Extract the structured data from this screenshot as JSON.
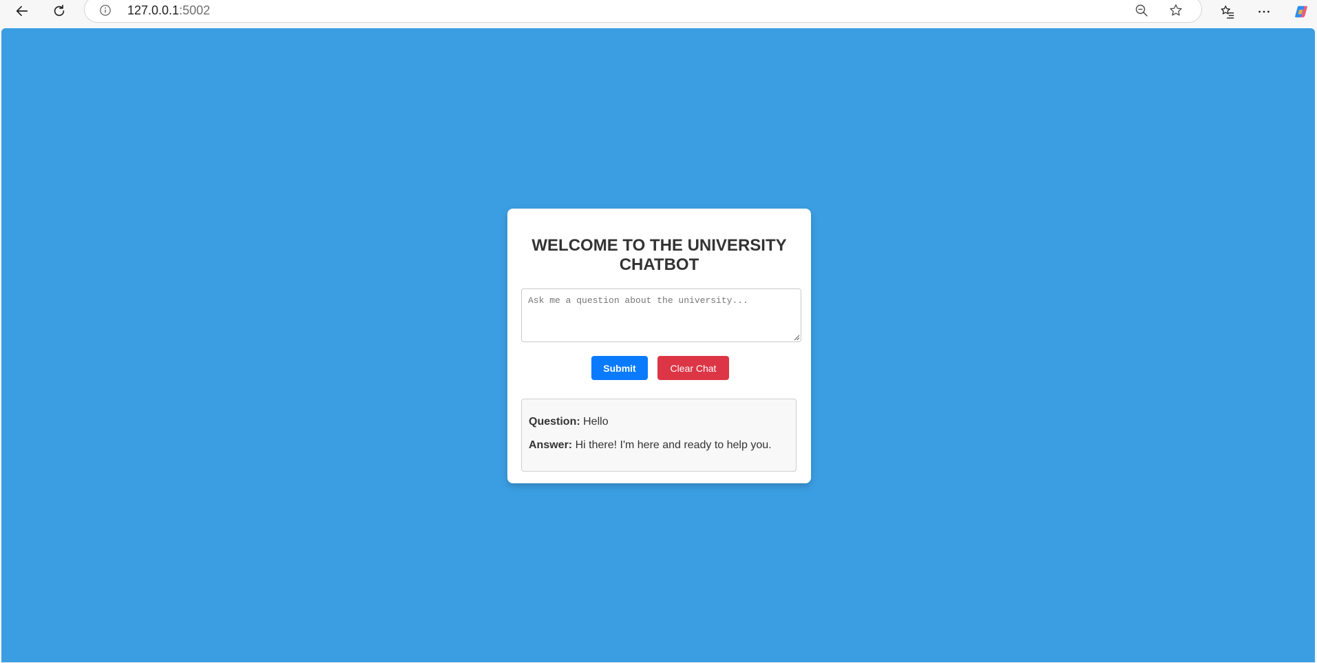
{
  "browser": {
    "url_host": "127.0.0.1",
    "url_port": ":5002",
    "icons": {
      "back": "back-arrow-icon",
      "reload": "reload-icon",
      "info": "info-icon",
      "zoom": "zoom-out-icon",
      "favorite": "star-icon",
      "favorites": "favorites-list-icon",
      "more": "more-dots-icon",
      "copilot": "copilot-icon"
    }
  },
  "page": {
    "background_color": "#3b9ee2"
  },
  "chatbot": {
    "title": "WELCOME TO THE UNIVERSITY CHATBOT",
    "input_placeholder": "Ask me a question about the university...",
    "input_value": "",
    "submit_label": "Submit",
    "clear_label": "Clear Chat",
    "submit_color": "#0a7bff",
    "clear_color": "#dc3545",
    "conversation": {
      "question_label": "Question:",
      "question_text": "Hello",
      "answer_label": "Answer:",
      "answer_text": "Hi there! I'm here and ready to help you."
    }
  }
}
